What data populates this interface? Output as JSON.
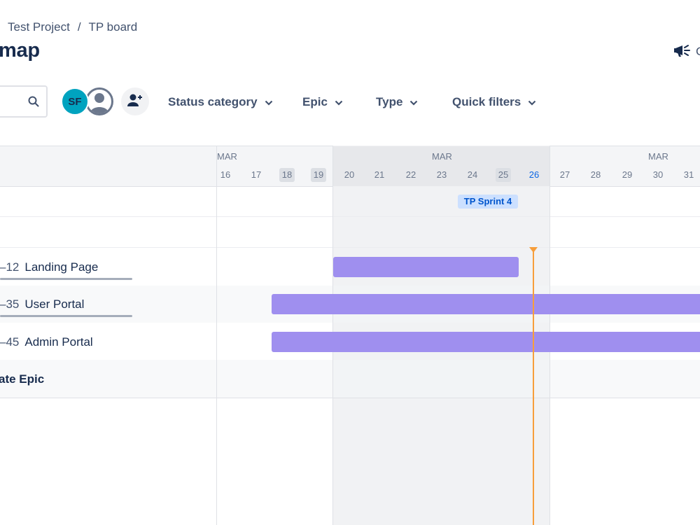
{
  "breadcrumb": {
    "project": "Test Project",
    "separator": "/",
    "board": "TP board"
  },
  "page": {
    "title": "map"
  },
  "header": {
    "announce_label": "G"
  },
  "toolbar": {
    "search_icon": "search-icon",
    "avatar_initials": "SF",
    "filters": [
      {
        "label": "Status category"
      },
      {
        "label": "Epic"
      },
      {
        "label": "Type"
      },
      {
        "label": "Quick filters"
      }
    ]
  },
  "timeline": {
    "months": [
      "MAR",
      "MAR",
      "MAR"
    ],
    "days": [
      "16",
      "17",
      "18",
      "19",
      "20",
      "21",
      "22",
      "23",
      "24",
      "25",
      "26",
      "27",
      "28",
      "29",
      "30",
      "31"
    ],
    "weekend_days": [
      "18",
      "19",
      "25"
    ],
    "today": "26",
    "sprint_label": "TP Sprint 4"
  },
  "epics": [
    {
      "key": "–12",
      "name": "Landing Page"
    },
    {
      "key": "–35",
      "name": "User Portal"
    },
    {
      "key": "–45",
      "name": "Admin Portal"
    }
  ],
  "create_epic_label": "ate Epic",
  "colors": {
    "bar": "#9f8fef",
    "today": "#f79e3b",
    "sprint_label_bg": "#cce0ff",
    "avatar_sf": "#00a3bf"
  }
}
